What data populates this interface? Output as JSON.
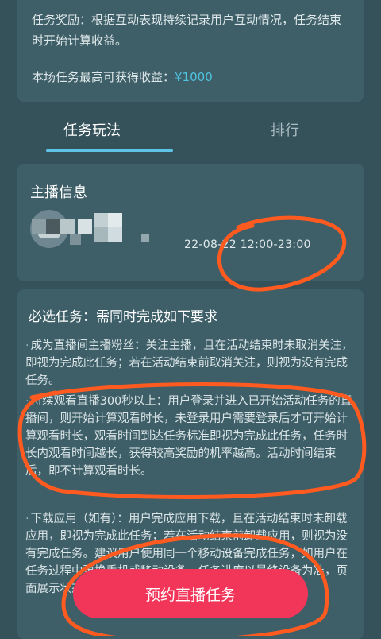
{
  "reward": {
    "text": "任务奖励：根据互动表现持续记录用户互动情况，任务结束时开始计算收益。",
    "max_prefix": "本场任务最高可获得收益：",
    "max_amount": "¥1000"
  },
  "tabs": [
    {
      "label": "任务玩法",
      "active": true
    },
    {
      "label": "排行",
      "active": false
    }
  ],
  "anchor": {
    "title": "主播信息",
    "time": "22-08-22 12:00-23:00"
  },
  "tasks": {
    "title": "必选任务：需同时完成如下要求",
    "items": [
      "成为直播间主播粉丝：关注主播，且在活动结束时未取消关注，即视为完成此任务；若在活动结束前取消关注，则视为没有完成任务。",
      "持续观看直播300秒以上：用户登录并进入已开始活动任务的直播间，则开始计算观看时长，未登录用户需要登录后才可开始计算观看时长，观看时间到达任务标准即视为完成此任务，任务时长内观看时间越长，获得较高奖励的机率越高。活动时间结束后，即不计算观看时长。",
      "下载应用（如有）：用户完成应用下载，且在活动结束时未卸载应用，即视为完成此任务；若在活动结束前卸载应用，则视为没有完成任务。建议用户使用同一个移动设备完成任务，如用户在任务过程中更换手机或移动设备，任务进度以最终设备为准，页面展示状态为准。"
    ]
  },
  "cta_label": "预约直播任务",
  "colors": {
    "background": "#35525a",
    "card": "#3e5f68",
    "accent": "#5ec4e8",
    "cta": "#f2365a",
    "annotation": "#ff5a1f"
  }
}
